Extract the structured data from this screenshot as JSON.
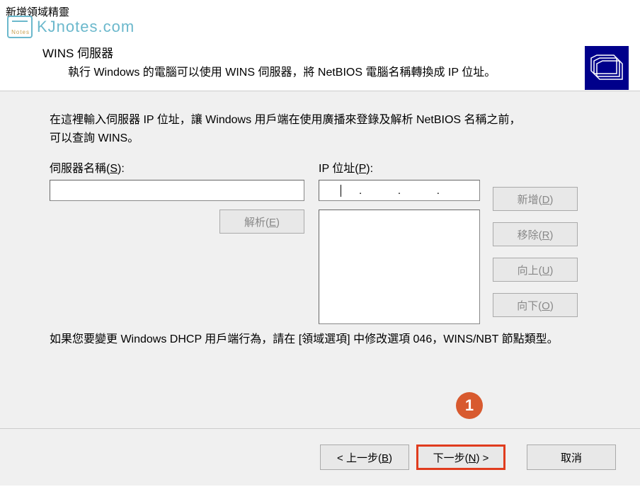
{
  "window": {
    "title": "新增領域精靈"
  },
  "watermark": {
    "text": "KJnotes.com"
  },
  "header": {
    "title": "WINS 伺服器",
    "description": "執行 Windows 的電腦可以使用 WINS 伺服器，將 NetBIOS 電腦名稱轉換成 IP 位址。"
  },
  "content": {
    "instruction_line1": "在這裡輸入伺服器 IP 位址，讓 Windows 用戶端在使用廣播來登錄及解析 NetBIOS 名稱之前，",
    "instruction_line2": "可以查詢 WINS。",
    "server_name_label": "伺服器名稱(",
    "server_name_key": "S",
    "server_name_label_end": "):",
    "ip_address_label": "IP 位址(",
    "ip_address_key": "P",
    "ip_address_label_end": "):",
    "server_name_value": "",
    "ip_value": [
      "",
      "",
      "",
      ""
    ],
    "note": "如果您要變更 Windows DHCP 用戶端行為，請在 [領域選項] 中修改選項 046，WINS/NBT 節點類型。"
  },
  "buttons": {
    "resolve": "解析(",
    "resolve_key": "E",
    "resolve_end": ")",
    "add": "新增(",
    "add_key": "D",
    "add_end": ")",
    "remove": "移除(",
    "remove_key": "R",
    "remove_end": ")",
    "up": "向上(",
    "up_key": "U",
    "up_end": ")",
    "down": "向下(",
    "down_key": "O",
    "down_end": ")",
    "back": "< 上一步(",
    "back_key": "B",
    "back_end": ")",
    "next": "下一步(",
    "next_key": "N",
    "next_end": ") >",
    "cancel": "取消"
  },
  "annotation": {
    "number": "1"
  }
}
